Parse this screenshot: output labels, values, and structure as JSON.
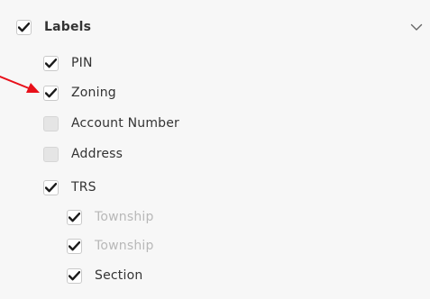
{
  "labels_panel": {
    "header": {
      "label": "Labels",
      "checked": true
    },
    "items": [
      {
        "label": "PIN",
        "checked": true,
        "dimmed": false
      },
      {
        "label": "Zoning",
        "checked": true,
        "dimmed": false
      },
      {
        "label": "Account Number",
        "checked": false,
        "dimmed": false
      },
      {
        "label": "Address",
        "checked": false,
        "dimmed": false
      },
      {
        "label": "TRS",
        "checked": true,
        "dimmed": false
      },
      {
        "label": "Township",
        "checked": true,
        "dimmed": true
      },
      {
        "label": "Township",
        "checked": true,
        "dimmed": true
      },
      {
        "label": "Section",
        "checked": true,
        "dimmed": false
      }
    ],
    "collapse_icon": "chevron-down-icon",
    "annotation_icon": "red-arrow-icon"
  },
  "colors": {
    "panel_bg": "#f7f7f7",
    "text": "#333333",
    "text_dim": "#b8b8b8",
    "check": "#1a1a1a",
    "arrow": "#e8101a"
  }
}
